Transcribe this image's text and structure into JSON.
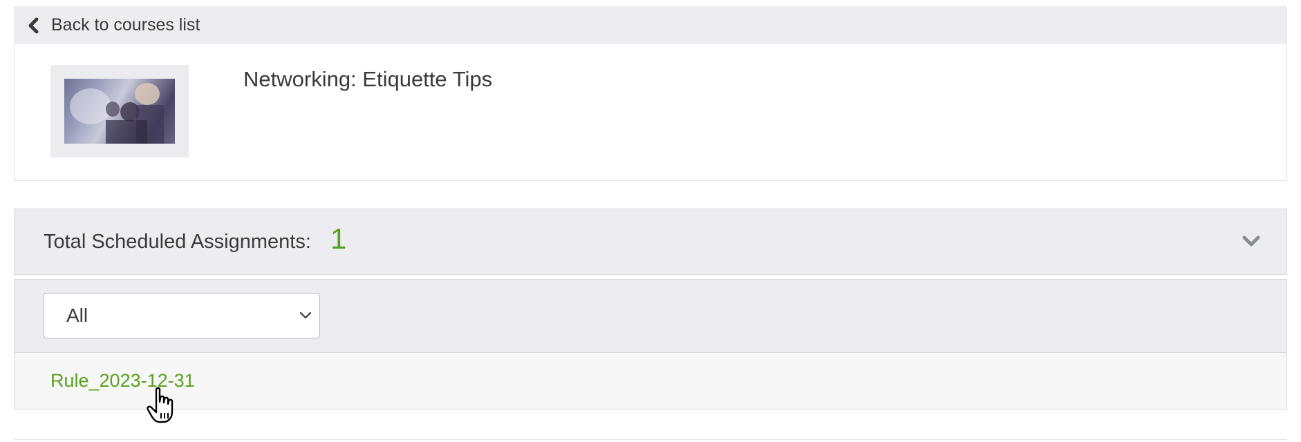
{
  "nav": {
    "back_label": "Back to courses list",
    "back_icon": "chevron-left-icon"
  },
  "course": {
    "title": "Networking: Etiquette Tips",
    "thumbnail": "course-thumbnail-photo"
  },
  "assignments": {
    "header_label": "Total Scheduled Assignments:",
    "count": "1",
    "count_color": "#5aa020",
    "collapse_icon": "chevron-down-icon"
  },
  "filter": {
    "selected_value": "All",
    "dropdown_icon": "chevron-down-icon"
  },
  "rules": [
    {
      "name": "Rule_2023-12-31"
    }
  ],
  "colors": {
    "accent_green": "#5aa020",
    "panel_gray": "#ededf1",
    "text": "#3a3a3a"
  }
}
